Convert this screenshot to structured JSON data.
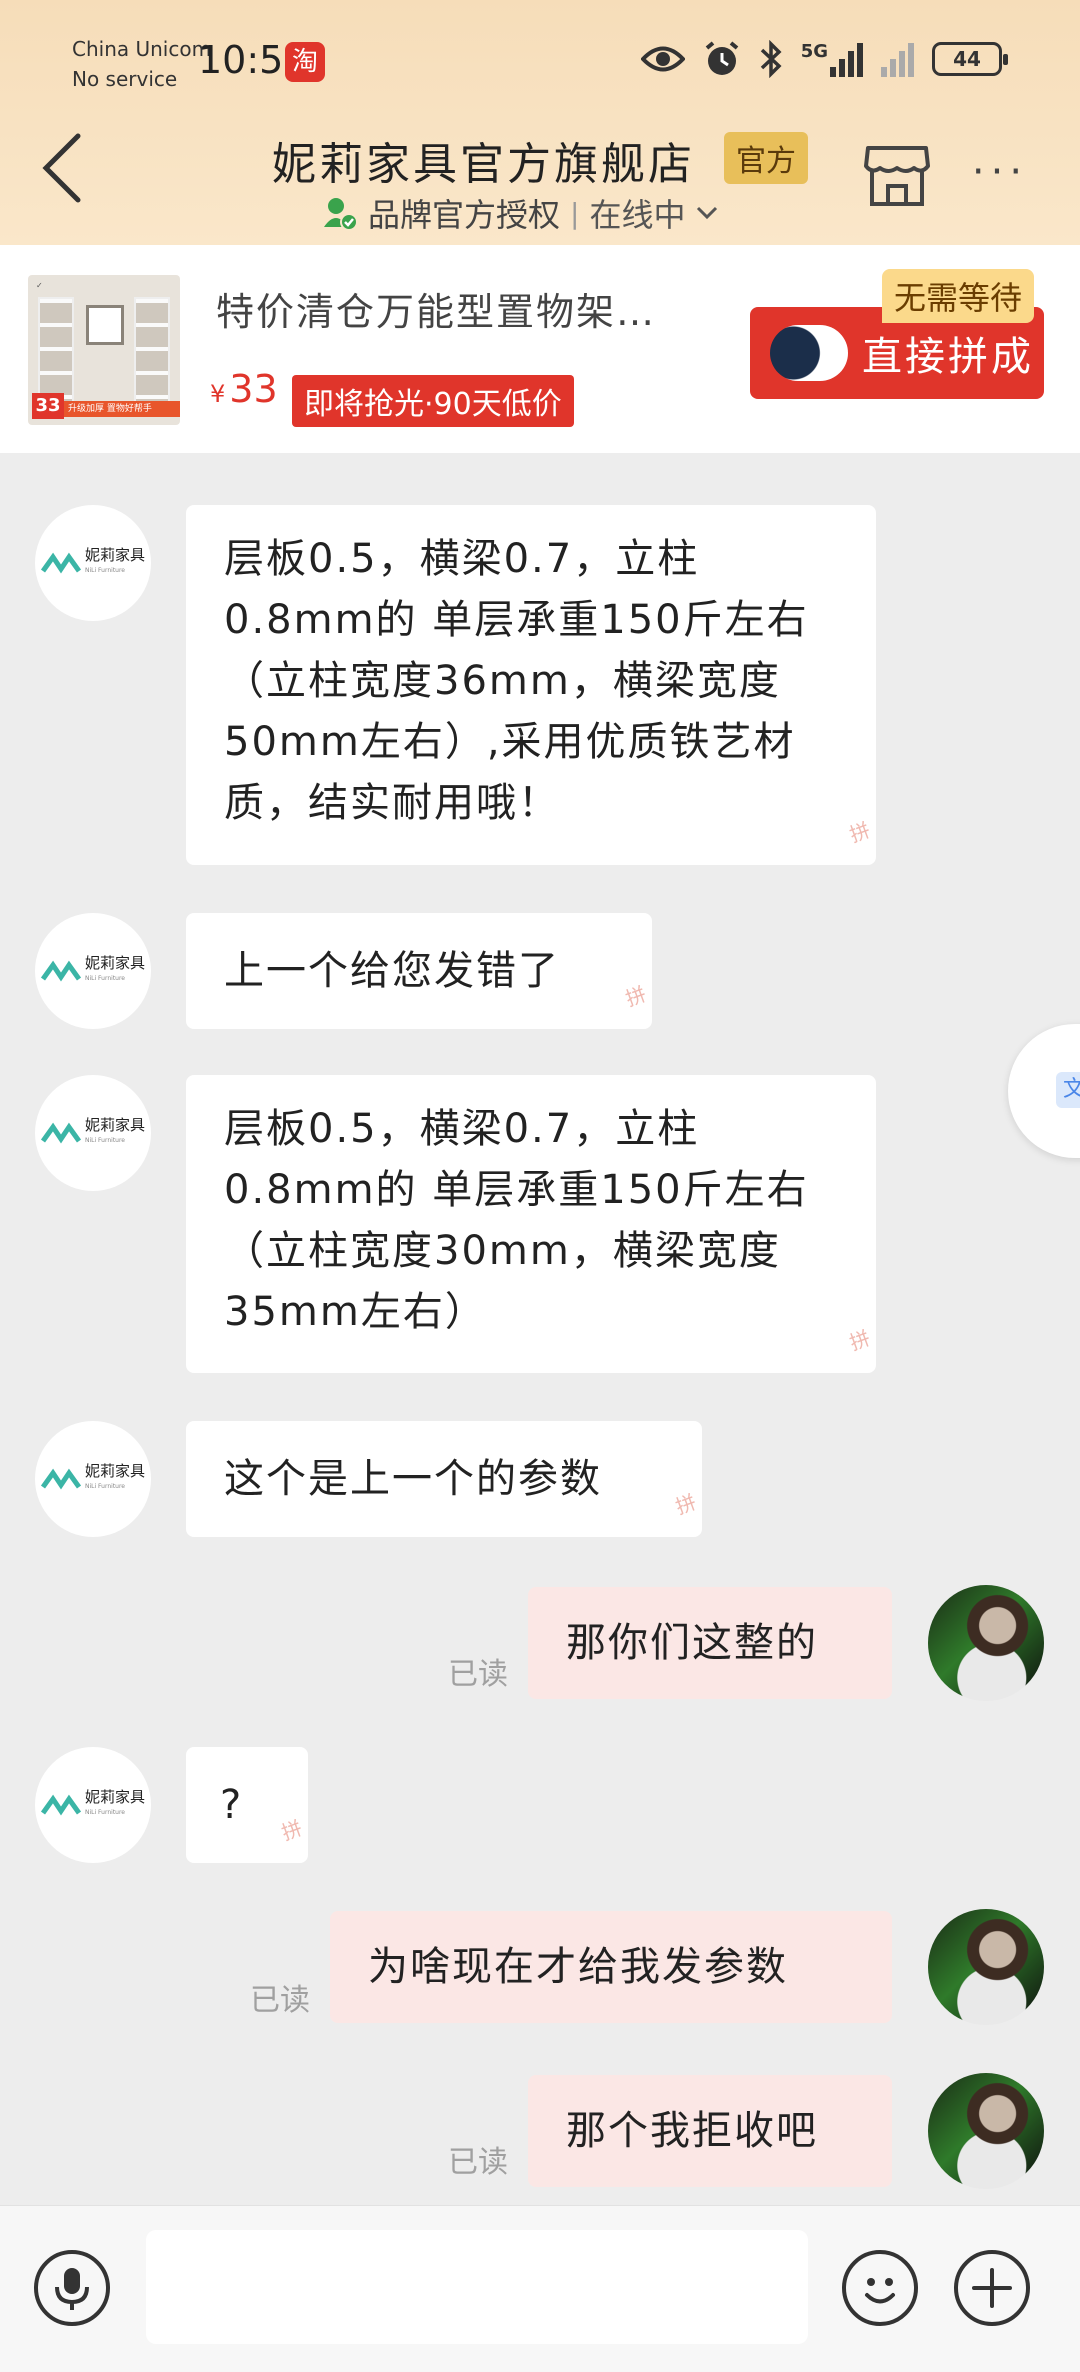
{
  "status_bar": {
    "carrier_line1": "China Unicom",
    "carrier_line2": "No service",
    "time": "10:55",
    "app_badge": "淘",
    "network": "5G",
    "battery": "44"
  },
  "header": {
    "shop_name": "妮莉家具官方旗舰店",
    "official_badge": "官方",
    "auth_text": "品牌官方授权",
    "online_status": "在线中",
    "more_label": "···"
  },
  "product": {
    "title": "特价清仓万能型置物架…",
    "currency": "¥",
    "price": "33",
    "tag": "即将抢光·90天低价",
    "no_wait_label": "无需等待",
    "buy_label": "直接拼成",
    "thumb_price": "33",
    "thumb_strip": "升级加厚 置物好帮手"
  },
  "shop_avatar": {
    "brand": "妮莉家具",
    "sub": "NiLi Furniture"
  },
  "messages": [
    {
      "side": "in",
      "text": "层板0.5，横梁0.7，立柱0.8mm的 单层承重150斤左右 （立柱宽度36mm，横梁宽度50mm左右）,采用优质铁艺材质，结实耐用哦！"
    },
    {
      "side": "in",
      "text": "上一个给您发错了"
    },
    {
      "side": "in",
      "text": "层板0.5，横梁0.7，立柱0.8mm的 单层承重150斤左右 （立柱宽度30mm，横梁宽度35mm左右）"
    },
    {
      "side": "in",
      "text": "这个是上一个的参数"
    },
    {
      "side": "out",
      "text": "那你们这整的",
      "read": "已读"
    },
    {
      "side": "in",
      "text": "?"
    },
    {
      "side": "out",
      "text": "为啥现在才给我发参数",
      "read": "已读"
    },
    {
      "side": "out",
      "text": "那个我拒收吧",
      "read": "已读"
    }
  ],
  "side_float": {
    "label": "文"
  },
  "input": {
    "placeholder": ""
  }
}
